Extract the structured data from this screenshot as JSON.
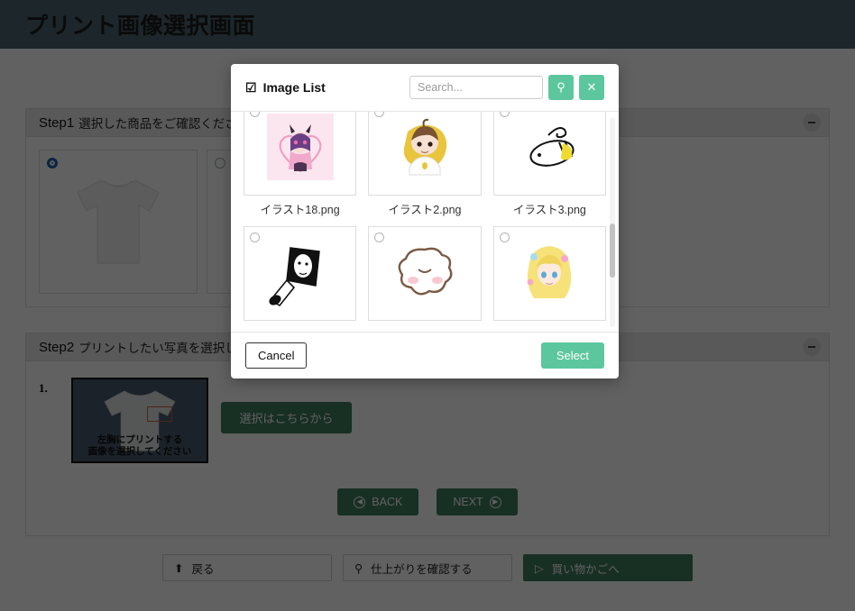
{
  "header": {
    "title": "プリント画像選択画面",
    "bg": "#4c6771"
  },
  "step1": {
    "step_label": "Step1",
    "title": "選択した商品をご確認ください",
    "collapse_icon": "minus-icon",
    "products": [
      {
        "name": "tshirt-white",
        "selected": true
      },
      {
        "name": "tshirt-alt",
        "selected": false
      }
    ]
  },
  "step2": {
    "step_label": "Step2",
    "title": "プリントしたい写真を選択してください",
    "collapse_icon": "minus-icon",
    "item_index": "1.",
    "thumb_caption_line1": "左胸にプリントする",
    "thumb_caption_line2": "画像を選択してください",
    "select_button": "選択はこちらから"
  },
  "nav": {
    "back_label": "BACK",
    "back_icon": "arrow-left-circle-icon",
    "next_label": "NEXT",
    "next_icon": "arrow-right-circle-icon"
  },
  "bottom_bar": {
    "buttons": [
      {
        "label": "戻る",
        "icon": "upload-icon",
        "primary": false
      },
      {
        "label": "仕上がりを確認する",
        "icon": "search-icon",
        "primary": false
      },
      {
        "label": "買い物かごへ",
        "icon": "play-circle-icon",
        "primary": true
      }
    ]
  },
  "modal": {
    "title": "Image List",
    "title_icon": "checkbox-checked-icon",
    "search": {
      "placeholder": "Search...",
      "value": ""
    },
    "search_button_icon": "search-icon",
    "clear_button_icon": "close-icon",
    "accent": "#5cc79e",
    "cancel_label": "Cancel",
    "select_label": "Select",
    "images": [
      {
        "filename": "イラスト18.png",
        "art": "anime-girl-heart",
        "selected": false
      },
      {
        "filename": "イラスト2.png",
        "art": "boy-yellow-blob",
        "selected": false
      },
      {
        "filename": "イラスト3.png",
        "art": "bee-sketch",
        "selected": false
      },
      {
        "filename": "",
        "art": "mirror-sketch",
        "selected": false
      },
      {
        "filename": "",
        "art": "sheep-face",
        "selected": false
      },
      {
        "filename": "",
        "art": "blonde-girl",
        "selected": false
      }
    ]
  }
}
